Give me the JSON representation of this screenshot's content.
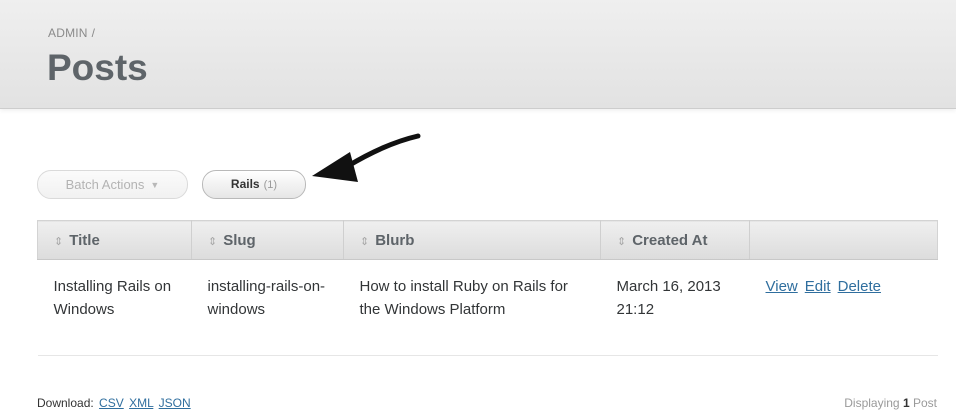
{
  "header": {
    "breadcrumb": "ADMIN",
    "breadcrumb_separator": "/",
    "title": "Posts"
  },
  "toolbar": {
    "batch_actions_label": "Batch Actions",
    "scope_name": "Rails",
    "scope_count": "(1)"
  },
  "table": {
    "columns": [
      {
        "label": "Title"
      },
      {
        "label": "Slug"
      },
      {
        "label": "Blurb"
      },
      {
        "label": "Created At"
      }
    ],
    "rows": [
      {
        "title": "Installing Rails on Windows",
        "slug": "installing-rails-on-windows",
        "blurb": "How to install Ruby on Rails for the Windows Platform",
        "created_at": "March 16, 2013 21:12",
        "actions": {
          "view": "View",
          "edit": "Edit",
          "delete": "Delete"
        }
      }
    ]
  },
  "footer": {
    "download_label": "Download:",
    "formats": [
      "CSV",
      "XML",
      "JSON"
    ],
    "pagination_prefix": "Displaying",
    "pagination_count": "1",
    "pagination_suffix": "Post"
  },
  "icons": {
    "sort": "sort-icon",
    "caret": "chevron-down-icon",
    "pointer": "arrow-pointer-icon"
  },
  "colors": {
    "link": "#2f6e9e",
    "title": "#5e6469"
  }
}
